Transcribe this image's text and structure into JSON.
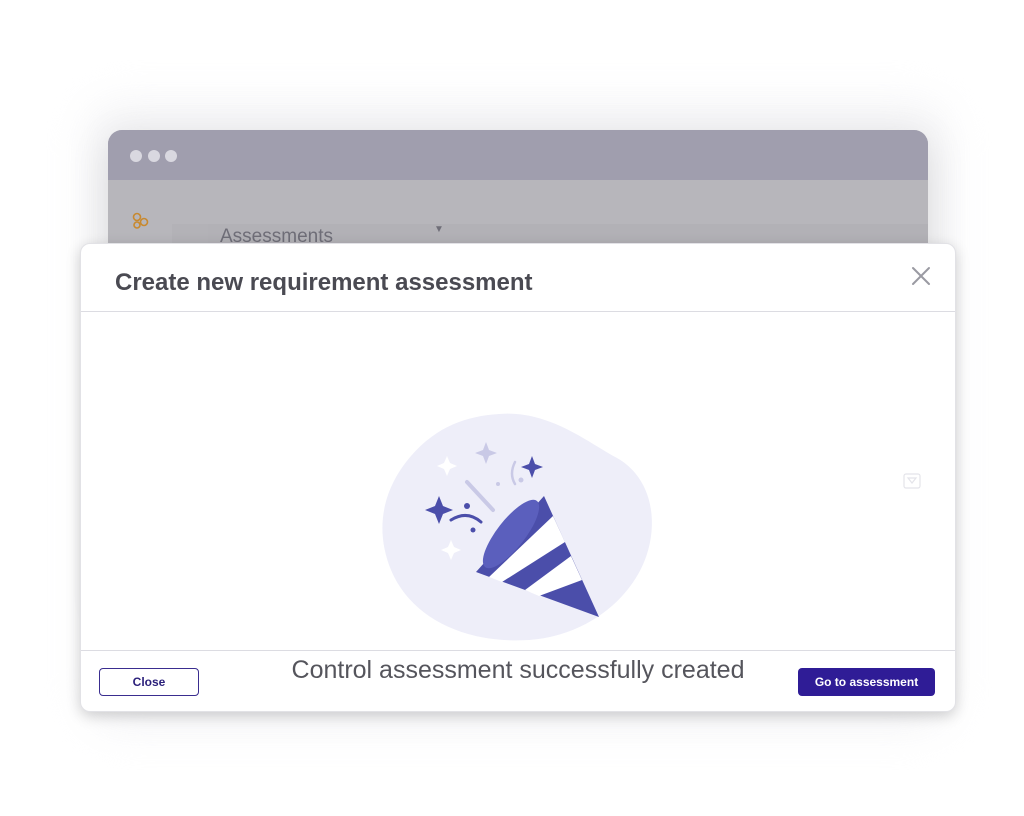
{
  "background_app": {
    "heading": "Assessments"
  },
  "modal": {
    "title": "Create new requirement assessment",
    "success_message": "Control assessment successfully created",
    "close_button_label": "Close",
    "go_button_label": "Go to assessment"
  },
  "icons": {
    "close": "close-icon",
    "logo": "app-logo-icon",
    "caret": "caret-down-icon",
    "illustration": "party-popper-illustration",
    "faint": "filter-icon"
  },
  "colors": {
    "primary": "#2f1c96",
    "illustration_purple": "#4b4eaa",
    "illustration_blob": "#eeeef9",
    "title_text": "#4a4a52"
  }
}
